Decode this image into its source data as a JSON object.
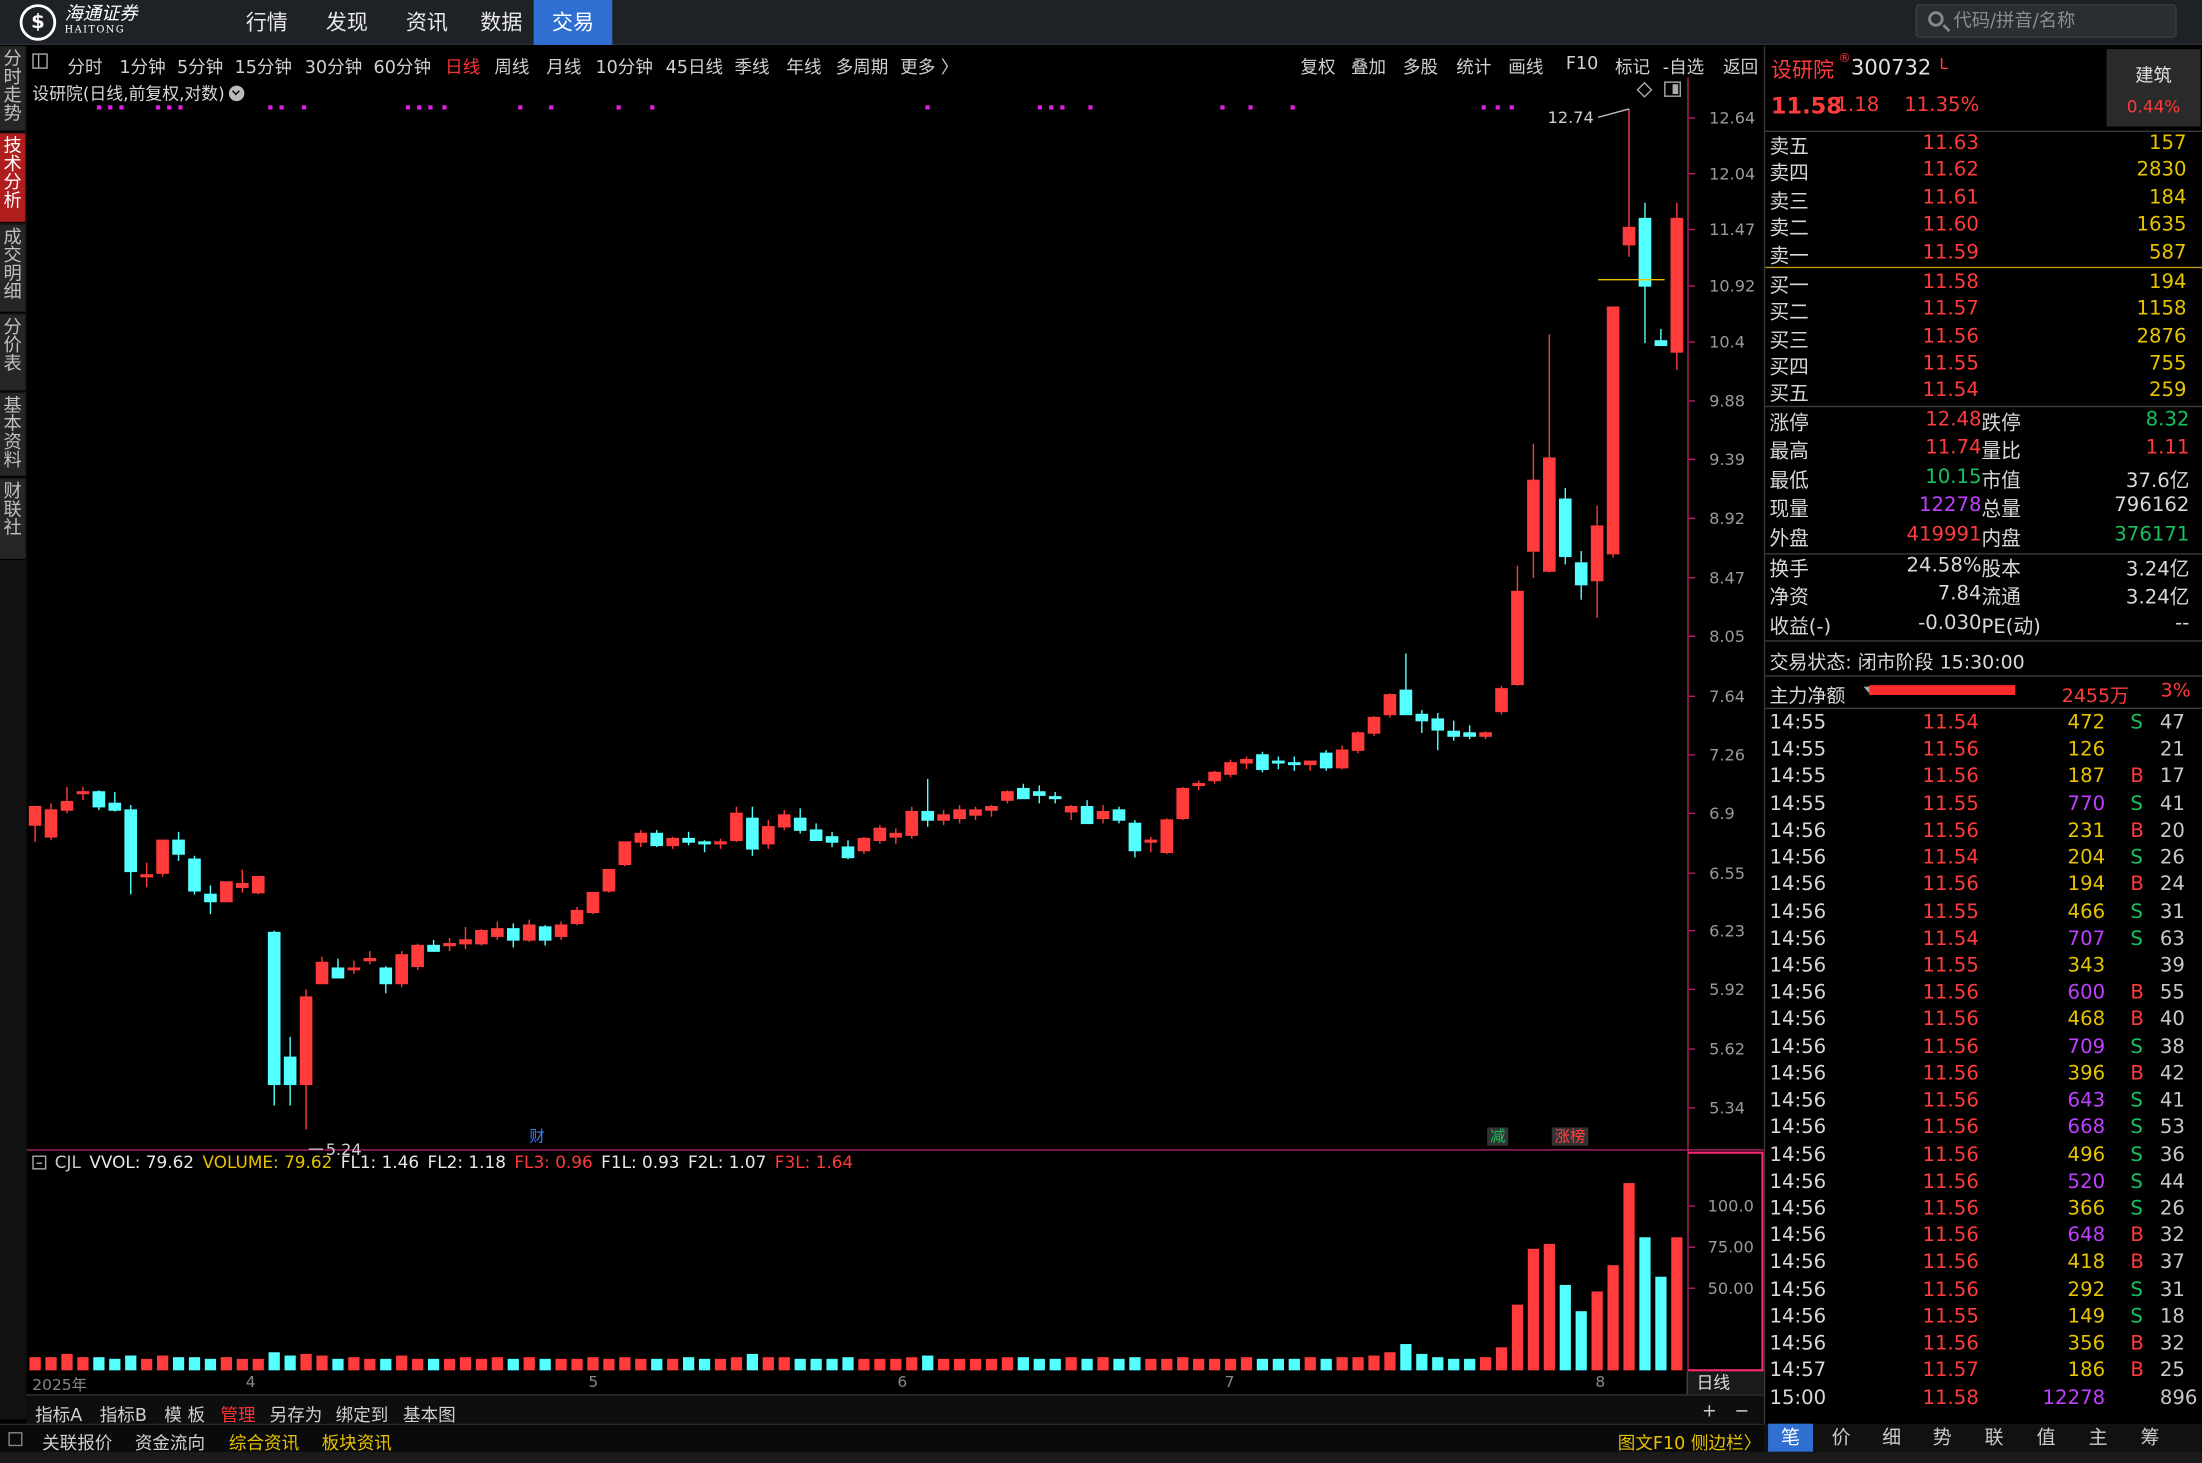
{
  "nav": {
    "logo_cn": "海通证券",
    "logo_en": "HAITONG",
    "menu": [
      "行情",
      "发现",
      "资讯",
      "数据",
      "交易"
    ],
    "active_menu": "交易",
    "search_placeholder": "代码/拼音/名称"
  },
  "left_tabs": [
    "分时走势",
    "技术分析",
    "成交明细",
    "分价表",
    "基本资料",
    "财联社"
  ],
  "left_tab_active": "技术分析",
  "periods": [
    "分时",
    "1分钟",
    "5分钟",
    "15分钟",
    "30分钟",
    "60分钟",
    "日线",
    "周线",
    "月线",
    "10分钟",
    "45日线",
    "季线",
    "年线",
    "多周期",
    "更多 〉"
  ],
  "period_active": "日线",
  "tools": [
    "复权",
    "叠加",
    "多股",
    "统计",
    "画线",
    "F10",
    "标记",
    "-自选",
    "返回"
  ],
  "chart_title": "设研院(日线,前复权,对数)",
  "chart_data": {
    "type": "candlestick",
    "price_axis": {
      "ticks": [
        12.64,
        12.04,
        11.47,
        10.92,
        10.4,
        9.88,
        9.39,
        8.92,
        8.47,
        8.05,
        7.64,
        7.26,
        6.9,
        6.55,
        6.23,
        5.92,
        5.62,
        5.34
      ],
      "scale": "log"
    },
    "annotations": {
      "high_label": "12.74",
      "low_label": "5.24"
    },
    "markers": [
      {
        "text": "财",
        "color": "#3a7bff"
      },
      {
        "text": "减",
        "color": "#18c060"
      },
      {
        "text": "涨榜",
        "color": "#ff4040"
      }
    ],
    "candles": [
      {
        "o": 6.83,
        "h": 6.94,
        "l": 6.73,
        "c": 6.94
      },
      {
        "o": 6.76,
        "h": 6.96,
        "l": 6.74,
        "c": 6.92
      },
      {
        "o": 6.92,
        "h": 7.06,
        "l": 6.9,
        "c": 6.97
      },
      {
        "o": 7.02,
        "h": 7.06,
        "l": 6.98,
        "c": 7.03
      },
      {
        "o": 7.03,
        "h": 7.04,
        "l": 6.92,
        "c": 6.94
      },
      {
        "o": 6.96,
        "h": 7.03,
        "l": 6.91,
        "c": 6.92
      },
      {
        "o": 6.92,
        "h": 6.95,
        "l": 6.43,
        "c": 6.56
      },
      {
        "o": 6.53,
        "h": 6.61,
        "l": 6.47,
        "c": 6.54
      },
      {
        "o": 6.55,
        "h": 6.74,
        "l": 6.53,
        "c": 6.74
      },
      {
        "o": 6.74,
        "h": 6.79,
        "l": 6.62,
        "c": 6.66
      },
      {
        "o": 6.63,
        "h": 6.65,
        "l": 6.43,
        "c": 6.45
      },
      {
        "o": 6.43,
        "h": 6.48,
        "l": 6.32,
        "c": 6.39
      },
      {
        "o": 6.39,
        "h": 6.5,
        "l": 6.39,
        "c": 6.5
      },
      {
        "o": 6.47,
        "h": 6.57,
        "l": 6.44,
        "c": 6.49
      },
      {
        "o": 6.44,
        "h": 6.53,
        "l": 6.43,
        "c": 6.53
      },
      {
        "o": 6.22,
        "h": 6.23,
        "l": 5.35,
        "c": 5.45
      },
      {
        "o": 5.58,
        "h": 5.68,
        "l": 5.35,
        "c": 5.45
      },
      {
        "o": 5.45,
        "h": 5.92,
        "l": 5.24,
        "c": 5.88
      },
      {
        "o": 5.95,
        "h": 6.09,
        "l": 5.96,
        "c": 6.06
      },
      {
        "o": 6.03,
        "h": 6.08,
        "l": 5.98,
        "c": 5.98
      },
      {
        "o": 6.03,
        "h": 6.07,
        "l": 6.0,
        "c": 6.03
      },
      {
        "o": 6.07,
        "h": 6.12,
        "l": 6.05,
        "c": 6.08
      },
      {
        "o": 6.03,
        "h": 6.04,
        "l": 5.9,
        "c": 5.95
      },
      {
        "o": 5.95,
        "h": 6.12,
        "l": 5.93,
        "c": 6.1
      },
      {
        "o": 6.04,
        "h": 6.16,
        "l": 6.02,
        "c": 6.15
      },
      {
        "o": 6.15,
        "h": 6.18,
        "l": 6.12,
        "c": 6.12
      },
      {
        "o": 6.15,
        "h": 6.19,
        "l": 6.12,
        "c": 6.16
      },
      {
        "o": 6.16,
        "h": 6.25,
        "l": 6.13,
        "c": 6.18
      },
      {
        "o": 6.16,
        "h": 6.24,
        "l": 6.15,
        "c": 6.23
      },
      {
        "o": 6.2,
        "h": 6.28,
        "l": 6.18,
        "c": 6.24
      },
      {
        "o": 6.24,
        "h": 6.27,
        "l": 6.14,
        "c": 6.18
      },
      {
        "o": 6.18,
        "h": 6.29,
        "l": 6.17,
        "c": 6.26
      },
      {
        "o": 6.25,
        "h": 6.26,
        "l": 6.15,
        "c": 6.18
      },
      {
        "o": 6.2,
        "h": 6.28,
        "l": 6.18,
        "c": 6.26
      },
      {
        "o": 6.27,
        "h": 6.36,
        "l": 6.26,
        "c": 6.34
      },
      {
        "o": 6.33,
        "h": 6.44,
        "l": 6.32,
        "c": 6.44
      },
      {
        "o": 6.45,
        "h": 6.57,
        "l": 6.44,
        "c": 6.57
      },
      {
        "o": 6.6,
        "h": 6.73,
        "l": 6.59,
        "c": 6.73
      },
      {
        "o": 6.73,
        "h": 6.8,
        "l": 6.7,
        "c": 6.78
      },
      {
        "o": 6.78,
        "h": 6.8,
        "l": 6.7,
        "c": 6.71
      },
      {
        "o": 6.71,
        "h": 6.76,
        "l": 6.69,
        "c": 6.75
      },
      {
        "o": 6.75,
        "h": 6.79,
        "l": 6.71,
        "c": 6.73
      },
      {
        "o": 6.73,
        "h": 6.74,
        "l": 6.67,
        "c": 6.72
      },
      {
        "o": 6.72,
        "h": 6.75,
        "l": 6.69,
        "c": 6.73
      },
      {
        "o": 6.74,
        "h": 6.94,
        "l": 6.73,
        "c": 6.9
      },
      {
        "o": 6.87,
        "h": 6.94,
        "l": 6.65,
        "c": 6.69
      },
      {
        "o": 6.72,
        "h": 6.86,
        "l": 6.69,
        "c": 6.82
      },
      {
        "o": 6.82,
        "h": 6.92,
        "l": 6.8,
        "c": 6.89
      },
      {
        "o": 6.87,
        "h": 6.93,
        "l": 6.78,
        "c": 6.8
      },
      {
        "o": 6.8,
        "h": 6.84,
        "l": 6.74,
        "c": 6.74
      },
      {
        "o": 6.76,
        "h": 6.79,
        "l": 6.7,
        "c": 6.73
      },
      {
        "o": 6.7,
        "h": 6.74,
        "l": 6.63,
        "c": 6.64
      },
      {
        "o": 6.68,
        "h": 6.76,
        "l": 6.66,
        "c": 6.75
      },
      {
        "o": 6.74,
        "h": 6.83,
        "l": 6.72,
        "c": 6.81
      },
      {
        "o": 6.76,
        "h": 6.81,
        "l": 6.72,
        "c": 6.78
      },
      {
        "o": 6.77,
        "h": 6.94,
        "l": 6.75,
        "c": 6.91
      },
      {
        "o": 6.91,
        "h": 7.11,
        "l": 6.82,
        "c": 6.86
      },
      {
        "o": 6.86,
        "h": 6.92,
        "l": 6.83,
        "c": 6.89
      },
      {
        "o": 6.87,
        "h": 6.95,
        "l": 6.84,
        "c": 6.92
      },
      {
        "o": 6.89,
        "h": 6.94,
        "l": 6.86,
        "c": 6.92
      },
      {
        "o": 6.92,
        "h": 6.95,
        "l": 6.88,
        "c": 6.94
      },
      {
        "o": 6.98,
        "h": 7.04,
        "l": 6.96,
        "c": 7.03
      },
      {
        "o": 7.05,
        "h": 7.08,
        "l": 6.99,
        "c": 6.99
      },
      {
        "o": 7.03,
        "h": 7.07,
        "l": 6.96,
        "c": 7.01
      },
      {
        "o": 7.0,
        "h": 7.03,
        "l": 6.96,
        "c": 6.99
      },
      {
        "o": 6.91,
        "h": 6.95,
        "l": 6.86,
        "c": 6.94
      },
      {
        "o": 6.94,
        "h": 6.98,
        "l": 6.84,
        "c": 6.84
      },
      {
        "o": 6.87,
        "h": 6.95,
        "l": 6.84,
        "c": 6.91
      },
      {
        "o": 6.92,
        "h": 6.94,
        "l": 6.84,
        "c": 6.86
      },
      {
        "o": 6.84,
        "h": 6.86,
        "l": 6.64,
        "c": 6.68
      },
      {
        "o": 6.73,
        "h": 6.76,
        "l": 6.67,
        "c": 6.74
      },
      {
        "o": 6.67,
        "h": 6.87,
        "l": 6.66,
        "c": 6.86
      },
      {
        "o": 6.87,
        "h": 7.06,
        "l": 6.86,
        "c": 7.05
      },
      {
        "o": 7.07,
        "h": 7.1,
        "l": 7.04,
        "c": 7.08
      },
      {
        "o": 7.1,
        "h": 7.16,
        "l": 7.08,
        "c": 7.15
      },
      {
        "o": 7.14,
        "h": 7.23,
        "l": 7.12,
        "c": 7.21
      },
      {
        "o": 7.21,
        "h": 7.25,
        "l": 7.17,
        "c": 7.23
      },
      {
        "o": 7.26,
        "h": 7.28,
        "l": 7.15,
        "c": 7.17
      },
      {
        "o": 7.22,
        "h": 7.25,
        "l": 7.17,
        "c": 7.21
      },
      {
        "o": 7.21,
        "h": 7.25,
        "l": 7.16,
        "c": 7.2
      },
      {
        "o": 7.2,
        "h": 7.22,
        "l": 7.16,
        "c": 7.22
      },
      {
        "o": 7.27,
        "h": 7.29,
        "l": 7.16,
        "c": 7.18
      },
      {
        "o": 7.18,
        "h": 7.32,
        "l": 7.17,
        "c": 7.29
      },
      {
        "o": 7.29,
        "h": 7.41,
        "l": 7.27,
        "c": 7.4
      },
      {
        "o": 7.4,
        "h": 7.51,
        "l": 7.38,
        "c": 7.5
      },
      {
        "o": 7.52,
        "h": 7.66,
        "l": 7.5,
        "c": 7.65
      },
      {
        "o": 7.68,
        "h": 7.93,
        "l": 7.52,
        "c": 7.52
      },
      {
        "o": 7.52,
        "h": 7.55,
        "l": 7.4,
        "c": 7.48
      },
      {
        "o": 7.49,
        "h": 7.53,
        "l": 7.29,
        "c": 7.42
      },
      {
        "o": 7.41,
        "h": 7.48,
        "l": 7.35,
        "c": 7.38
      },
      {
        "o": 7.4,
        "h": 7.45,
        "l": 7.36,
        "c": 7.38
      },
      {
        "o": 7.38,
        "h": 7.41,
        "l": 7.36,
        "c": 7.4
      },
      {
        "o": 7.54,
        "h": 7.71,
        "l": 7.52,
        "c": 7.69
      },
      {
        "o": 7.72,
        "h": 8.56,
        "l": 7.71,
        "c": 8.37
      },
      {
        "o": 8.67,
        "h": 9.52,
        "l": 8.47,
        "c": 9.22
      },
      {
        "o": 8.52,
        "h": 10.47,
        "l": 8.51,
        "c": 9.4
      },
      {
        "o": 9.07,
        "h": 9.16,
        "l": 8.57,
        "c": 8.63
      },
      {
        "o": 8.58,
        "h": 8.67,
        "l": 8.31,
        "c": 8.42
      },
      {
        "o": 8.45,
        "h": 9.02,
        "l": 8.18,
        "c": 8.86
      },
      {
        "o": 8.65,
        "h": 10.72,
        "l": 8.62,
        "c": 10.72
      },
      {
        "o": 11.32,
        "h": 12.74,
        "l": 11.2,
        "c": 11.49
      },
      {
        "o": 11.58,
        "h": 11.74,
        "l": 10.39,
        "c": 10.92
      },
      {
        "o": 10.41,
        "h": 10.52,
        "l": 10.37,
        "c": 10.37
      },
      {
        "o": 10.31,
        "h": 11.74,
        "l": 10.15,
        "c": 11.58
      }
    ],
    "volume": {
      "header": [
        {
          "label": "CJL",
          "color": "#c8c8c8"
        },
        {
          "label": "VVOL: 79.62",
          "color": "#e8e8e8"
        },
        {
          "label": "VOLUME: 79.62",
          "color": "#e6c200"
        },
        {
          "label": "FL1: 1.46",
          "color": "#e8e8e8"
        },
        {
          "label": "FL2: 1.18",
          "color": "#e8e8e8"
        },
        {
          "label": "FL3: 0.96",
          "color": "#ff3b3b"
        },
        {
          "label": "F1L: 0.93",
          "color": "#e8e8e8"
        },
        {
          "label": "F2L: 1.07",
          "color": "#e8e8e8"
        },
        {
          "label": "F3L: 1.64",
          "color": "#ff3b3b"
        }
      ],
      "ticks": [
        "100.0",
        "75.00",
        "50.00"
      ],
      "values": [
        8,
        8,
        10,
        8,
        8,
        7,
        9,
        7,
        9,
        8,
        8,
        7,
        8,
        7,
        7,
        11,
        9,
        10,
        9,
        7,
        8,
        7,
        7,
        9,
        7,
        7,
        7,
        8,
        7,
        8,
        7,
        8,
        7,
        7,
        7,
        8,
        7,
        8,
        7,
        7,
        7,
        8,
        7,
        7,
        8,
        10,
        8,
        8,
        7,
        7,
        7,
        8,
        7,
        7,
        7,
        8,
        9,
        7,
        7,
        7,
        7,
        8,
        8,
        7,
        7,
        8,
        7,
        8,
        7,
        8,
        7,
        7,
        8,
        7,
        7,
        7,
        8,
        7,
        7,
        7,
        8,
        7,
        8,
        8,
        9,
        11,
        16,
        10,
        8,
        7,
        7,
        8,
        14,
        40,
        74,
        77,
        52,
        36,
        48,
        64,
        114,
        81,
        57,
        81
      ]
    },
    "x_labels": [
      "2025年",
      "4",
      "5",
      "6",
      "7",
      "8"
    ]
  },
  "bottom_tools": [
    "指标A",
    "指标B",
    "模 板",
    "管理",
    "另存为",
    "绑定到",
    "基本图"
  ],
  "bottom_tool_active": "管理",
  "xaxis_badge": "日线",
  "status_bar": [
    "关联报价",
    "资金流向",
    "综合资讯",
    "板块资讯"
  ],
  "status_right": "图文F10 侧边栏〉",
  "status_plusminus": [
    "+",
    "−"
  ],
  "quote": {
    "name": "设研院",
    "reg": "®",
    "code": "300732",
    "flag": "L",
    "price": "11.58",
    "change": "1.18",
    "pct": "11.35%",
    "sector": "建筑",
    "sector_pct": "0.44%"
  },
  "asks": [
    {
      "label": "卖五",
      "price": "11.63",
      "vol": "157"
    },
    {
      "label": "卖四",
      "price": "11.62",
      "vol": "2830"
    },
    {
      "label": "卖三",
      "price": "11.61",
      "vol": "184"
    },
    {
      "label": "卖二",
      "price": "11.60",
      "vol": "1635"
    },
    {
      "label": "卖一",
      "price": "11.59",
      "vol": "587"
    }
  ],
  "bids": [
    {
      "label": "买一",
      "price": "11.58",
      "vol": "194"
    },
    {
      "label": "买二",
      "price": "11.57",
      "vol": "1158"
    },
    {
      "label": "买三",
      "price": "11.56",
      "vol": "2876"
    },
    {
      "label": "买四",
      "price": "11.55",
      "vol": "755"
    },
    {
      "label": "买五",
      "price": "11.54",
      "vol": "259"
    }
  ],
  "stats_a": [
    {
      "l1": "涨停",
      "v1": "12.48",
      "c1": "#ff3b3b",
      "l2": "跌停",
      "v2": "8.32",
      "c2": "#18c060"
    },
    {
      "l1": "最高",
      "v1": "11.74",
      "c1": "#ff3b3b",
      "l2": "量比",
      "v2": "1.11",
      "c2": "#ff3b3b"
    },
    {
      "l1": "最低",
      "v1": "10.15",
      "c1": "#18c060",
      "l2": "市值",
      "v2": "37.6亿",
      "c2": "#d8d8d8"
    },
    {
      "l1": "现量",
      "v1": "12278",
      "c1": "#c040ff",
      "l2": "总量",
      "v2": "796162",
      "c2": "#d8d8d8"
    },
    {
      "l1": "外盘",
      "v1": "419991",
      "c1": "#ff3b3b",
      "l2": "内盘",
      "v2": "376171",
      "c2": "#18c060"
    }
  ],
  "stats_b": [
    {
      "l1": "换手",
      "v1": "24.58%",
      "c1": "#d8d8d8",
      "l2": "股本",
      "v2": "3.24亿",
      "c2": "#d8d8d8"
    },
    {
      "l1": "净资",
      "v1": "7.84",
      "c1": "#d8d8d8",
      "l2": "流通",
      "v2": "3.24亿",
      "c2": "#d8d8d8"
    },
    {
      "l1": "收益(-)",
      "v1": "-0.030",
      "c1": "#d8d8d8",
      "l2": "PE(动)",
      "v2": "--",
      "c2": "#d8d8d8"
    }
  ],
  "trade_status": "交易状态: 闭市阶段 15:30:00",
  "main_force": {
    "label": "主力净额",
    "amount": "2455万",
    "pct": "3%"
  },
  "ticks": [
    {
      "t": "14:55",
      "p": "11.54",
      "v": "472",
      "bs": "S",
      "n": "47"
    },
    {
      "t": "14:55",
      "p": "11.56",
      "v": "126",
      "bs": "",
      "n": "21"
    },
    {
      "t": "14:55",
      "p": "11.56",
      "v": "187",
      "bs": "B",
      "n": "17"
    },
    {
      "t": "14:55",
      "p": "11.55",
      "v": "770",
      "bs": "S",
      "n": "41"
    },
    {
      "t": "14:56",
      "p": "11.56",
      "v": "231",
      "bs": "B",
      "n": "20"
    },
    {
      "t": "14:56",
      "p": "11.54",
      "v": "204",
      "bs": "S",
      "n": "26"
    },
    {
      "t": "14:56",
      "p": "11.56",
      "v": "194",
      "bs": "B",
      "n": "24"
    },
    {
      "t": "14:56",
      "p": "11.55",
      "v": "466",
      "bs": "S",
      "n": "31"
    },
    {
      "t": "14:56",
      "p": "11.54",
      "v": "707",
      "bs": "S",
      "n": "63"
    },
    {
      "t": "14:56",
      "p": "11.55",
      "v": "343",
      "bs": "",
      "n": "39"
    },
    {
      "t": "14:56",
      "p": "11.56",
      "v": "600",
      "bs": "B",
      "n": "55"
    },
    {
      "t": "14:56",
      "p": "11.56",
      "v": "468",
      "bs": "B",
      "n": "40"
    },
    {
      "t": "14:56",
      "p": "11.56",
      "v": "709",
      "bs": "S",
      "n": "38"
    },
    {
      "t": "14:56",
      "p": "11.56",
      "v": "396",
      "bs": "B",
      "n": "42"
    },
    {
      "t": "14:56",
      "p": "11.56",
      "v": "643",
      "bs": "S",
      "n": "41"
    },
    {
      "t": "14:56",
      "p": "11.56",
      "v": "668",
      "bs": "S",
      "n": "53"
    },
    {
      "t": "14:56",
      "p": "11.56",
      "v": "496",
      "bs": "S",
      "n": "36"
    },
    {
      "t": "14:56",
      "p": "11.56",
      "v": "520",
      "bs": "S",
      "n": "44"
    },
    {
      "t": "14:56",
      "p": "11.56",
      "v": "366",
      "bs": "S",
      "n": "26"
    },
    {
      "t": "14:56",
      "p": "11.56",
      "v": "648",
      "bs": "B",
      "n": "32"
    },
    {
      "t": "14:56",
      "p": "11.56",
      "v": "418",
      "bs": "B",
      "n": "37"
    },
    {
      "t": "14:56",
      "p": "11.56",
      "v": "292",
      "bs": "S",
      "n": "31"
    },
    {
      "t": "14:56",
      "p": "11.55",
      "v": "149",
      "bs": "S",
      "n": "18"
    },
    {
      "t": "14:56",
      "p": "11.56",
      "v": "356",
      "bs": "B",
      "n": "32"
    },
    {
      "t": "14:57",
      "p": "11.57",
      "v": "186",
      "bs": "B",
      "n": "25"
    },
    {
      "t": "15:00",
      "p": "11.58",
      "v": "12278",
      "bs": "",
      "n": "896"
    }
  ],
  "right_tabs": [
    "笔",
    "价",
    "细",
    "势",
    "联",
    "值",
    "主",
    "筹"
  ],
  "right_tab_active": "笔"
}
